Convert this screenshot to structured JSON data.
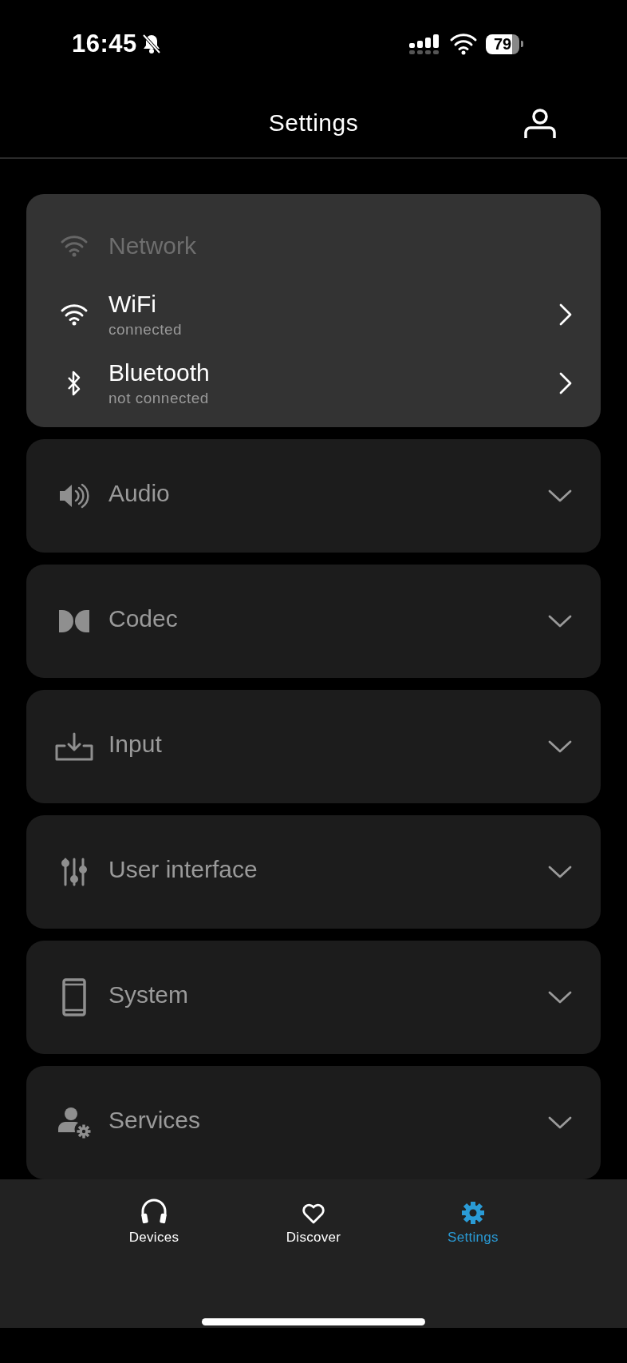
{
  "status_bar": {
    "time": "16:45",
    "battery": "79"
  },
  "header": {
    "title": "Settings"
  },
  "network": {
    "title": "Network",
    "items": [
      {
        "kind": "wifi",
        "title": "WiFi",
        "subtitle": "connected"
      },
      {
        "kind": "bluetooth",
        "title": "Bluetooth",
        "subtitle": "not connected"
      }
    ]
  },
  "sections": [
    {
      "kind": "audio",
      "title": "Audio",
      "expanded": false
    },
    {
      "kind": "codec",
      "title": "Codec",
      "expanded": false
    },
    {
      "kind": "input",
      "title": "Input",
      "expanded": false
    },
    {
      "kind": "sliders",
      "title": "User interface",
      "expanded": false
    },
    {
      "kind": "phone",
      "title": "System",
      "expanded": false
    },
    {
      "kind": "services",
      "title": "Services",
      "expanded": false
    }
  ],
  "tabs": [
    {
      "kind": "headphones",
      "label": "Devices",
      "selected": false
    },
    {
      "kind": "heart",
      "label": "Discover",
      "selected": false
    },
    {
      "kind": "gear",
      "label": "Settings",
      "selected": true
    }
  ]
}
